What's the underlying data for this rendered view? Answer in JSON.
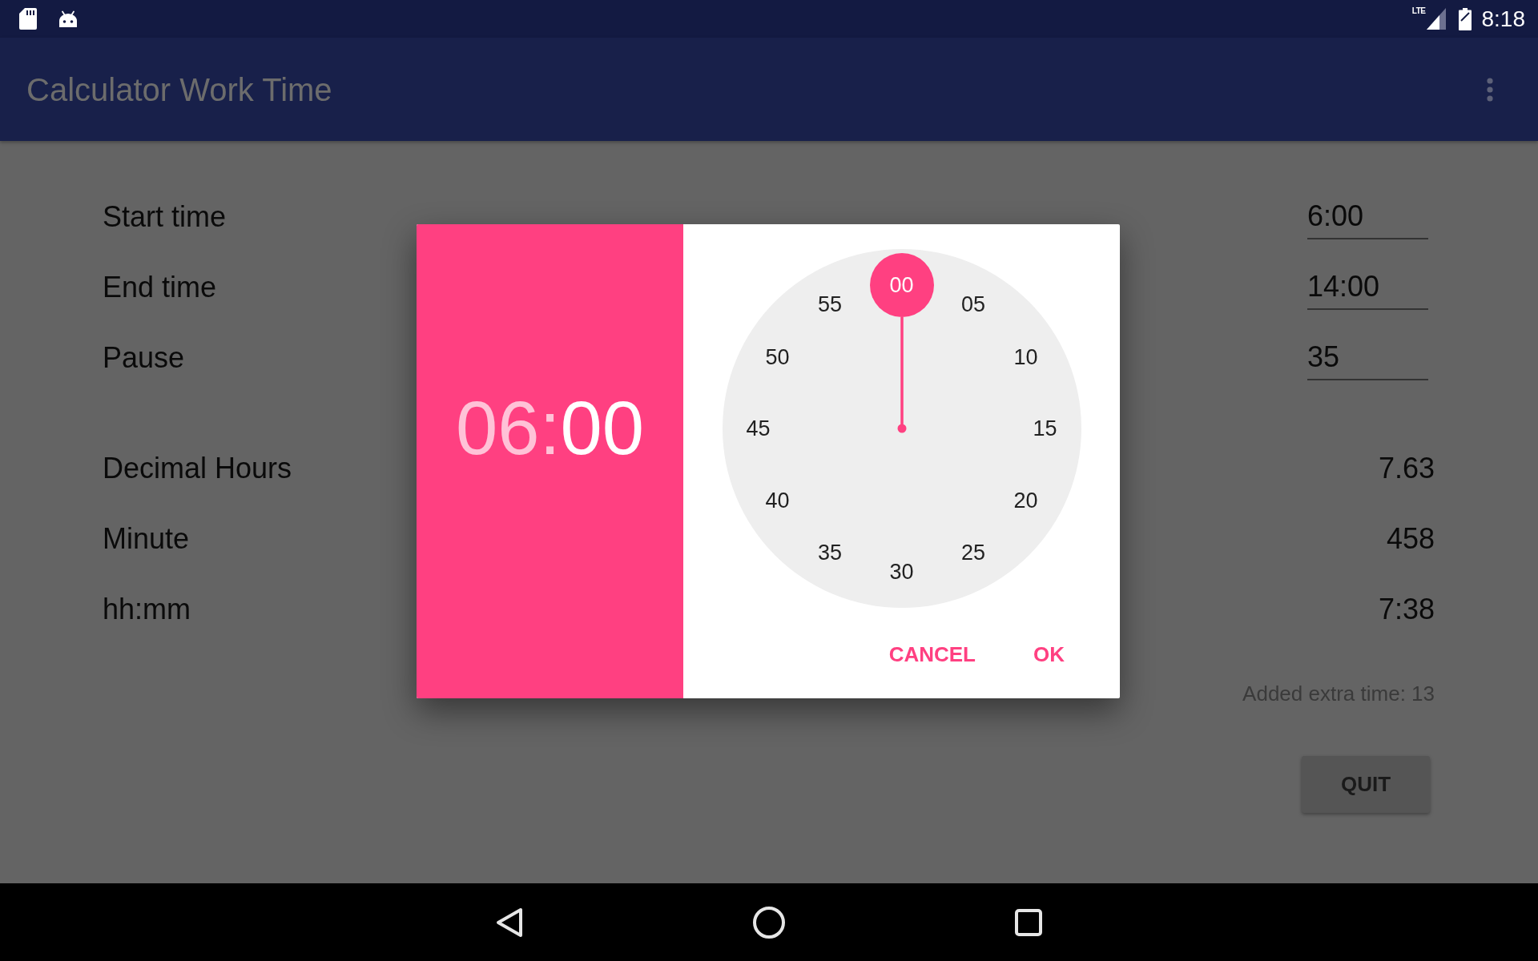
{
  "status_bar": {
    "network": "LTE",
    "time": "8:18"
  },
  "app_bar": {
    "title": "Calculator Work Time"
  },
  "inputs": [
    {
      "label": "Start time",
      "value": "6:00"
    },
    {
      "label": "End time",
      "value": "14:00"
    },
    {
      "label": "Pause",
      "value": "35"
    }
  ],
  "results": [
    {
      "label": "Decimal Hours",
      "value": "7.63"
    },
    {
      "label": "Minute",
      "value": "458"
    },
    {
      "label": "hh:mm",
      "value": "7:38"
    }
  ],
  "extra_time": "Added extra time: 13",
  "quit_button": "QUIT",
  "time_picker": {
    "hour": {
      "text": "06",
      "selected": false
    },
    "separator": ":",
    "minute": {
      "text": "00",
      "selected": true
    },
    "dial": [
      {
        "label": "00",
        "selected": true
      },
      {
        "label": "05",
        "selected": false
      },
      {
        "label": "10",
        "selected": false
      },
      {
        "label": "15",
        "selected": false
      },
      {
        "label": "20",
        "selected": false
      },
      {
        "label": "25",
        "selected": false
      },
      {
        "label": "30",
        "selected": false
      },
      {
        "label": "35",
        "selected": false
      },
      {
        "label": "40",
        "selected": false
      },
      {
        "label": "45",
        "selected": false
      },
      {
        "label": "50",
        "selected": false
      },
      {
        "label": "55",
        "selected": false
      }
    ],
    "buttons": [
      "CANCEL",
      "OK"
    ]
  }
}
